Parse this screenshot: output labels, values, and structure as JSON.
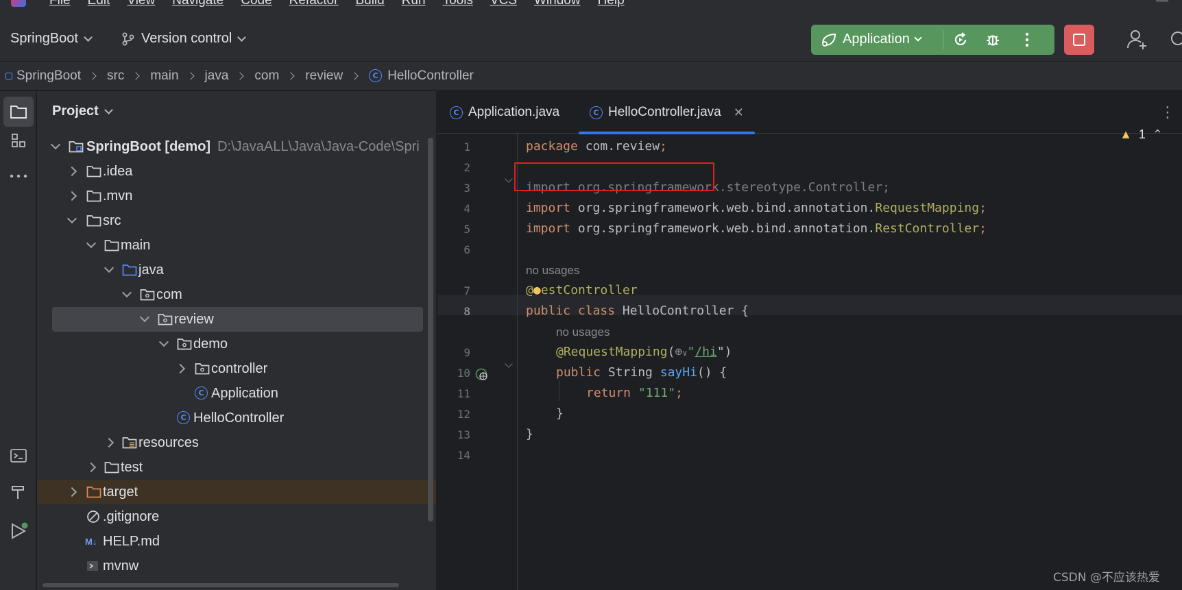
{
  "menu": {
    "items": [
      "File",
      "Edit",
      "View",
      "Navigate",
      "Code",
      "Refactor",
      "Build",
      "Run",
      "Tools",
      "VCS",
      "Window",
      "Help"
    ]
  },
  "toolbar": {
    "project_name": "SpringBoot",
    "version_control": "Version control",
    "run_config": "Application"
  },
  "breadcrumb": [
    "SpringBoot",
    "src",
    "main",
    "java",
    "com",
    "review",
    "HelloController"
  ],
  "project_panel": {
    "title": "Project",
    "root_label": "SpringBoot [demo]",
    "root_path": "D:\\JavaALL\\Java\\Java-Code\\Spri",
    "tree": [
      {
        "label": "SpringBoot [demo]",
        "icon": "module-folder-icon"
      },
      {
        "label": ".idea",
        "icon": "folder-icon"
      },
      {
        "label": ".mvn",
        "icon": "folder-icon"
      },
      {
        "label": "src",
        "icon": "folder-icon"
      },
      {
        "label": "main",
        "icon": "folder-icon"
      },
      {
        "label": "java",
        "icon": "source-folder-icon"
      },
      {
        "label": "com",
        "icon": "package-icon"
      },
      {
        "label": "review",
        "icon": "package-icon"
      },
      {
        "label": "demo",
        "icon": "package-icon"
      },
      {
        "label": "controller",
        "icon": "package-icon"
      },
      {
        "label": "Application",
        "icon": "spring-class-icon"
      },
      {
        "label": "HelloController",
        "icon": "class-icon"
      },
      {
        "label": "resources",
        "icon": "resources-folder-icon"
      },
      {
        "label": "test",
        "icon": "folder-icon"
      },
      {
        "label": "target",
        "icon": "excluded-folder-icon"
      },
      {
        "label": ".gitignore",
        "icon": "ignore-file-icon"
      },
      {
        "label": "HELP.md",
        "icon": "markdown-icon"
      },
      {
        "label": "mvnw",
        "icon": "shell-script-icon"
      }
    ]
  },
  "editor": {
    "tabs": [
      {
        "label": "Application.java",
        "active": false
      },
      {
        "label": "HelloController.java",
        "active": true
      }
    ],
    "warnings_count": "1",
    "line_numbers": [
      "1",
      "2",
      "3",
      "4",
      "5",
      "6",
      "7",
      "8",
      "9",
      "10",
      "11",
      "12",
      "13",
      "14"
    ],
    "current_line": "8",
    "hints": {
      "usages_1": "no usages",
      "usages_2": "no usages"
    },
    "code": {
      "l1_kw": "package",
      "l1_rest": " com.review",
      "l1_semi": ";",
      "l3": "import org.springframework.stereotype.Controller;",
      "l4_kw": "import",
      "l4_pkg": " org.springframework.web.bind.annotation.",
      "l4_cls": "RequestMapping",
      "l4_semi": ";",
      "l5_kw": "import",
      "l5_pkg": " org.springframework.web.bind.annotation.",
      "l5_cls": "RestController",
      "l5_semi": ";",
      "l7_at": "@",
      "l7_ann": "estController",
      "l8_kw": "public class",
      "l8_name": " HelloController {",
      "l9_ann": "@RequestMapping",
      "l9_open": "(",
      "l9_quote": "\"",
      "l9_path": "/hi",
      "l9_close": "\")",
      "l10_kw": "public",
      "l10_type": " String ",
      "l10_fn": "sayHi",
      "l10_rest": "() {",
      "l11_kw": "return",
      "l11_str": " \"111\"",
      "l11_semi": ";",
      "l12": "}",
      "l13": "}"
    }
  },
  "watermark": "CSDN @不应该热爱",
  "colors": {
    "run_group": "#57965c",
    "stop_button": "#db5c5c",
    "highlight_box": "#e02020",
    "accent": "#3574f0"
  }
}
